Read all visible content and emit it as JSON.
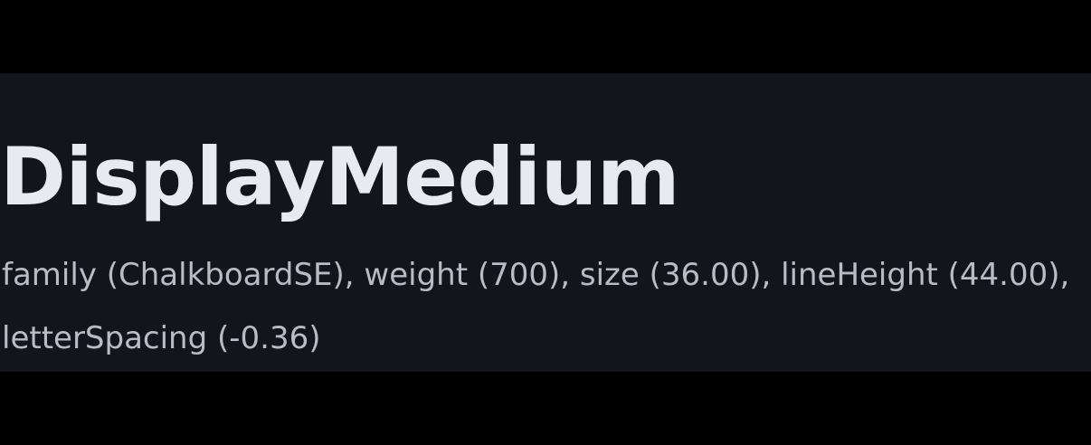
{
  "sample": {
    "title": "DisplayMedium",
    "description": "family (ChalkboardSE), weight (700), size (36.00), lineHeight (44.00), letterSpacing (-0.36)"
  },
  "colors": {
    "background": "#000000",
    "panel": "#12151c",
    "title": "#e8eaef",
    "description": "#b9bcc6"
  }
}
